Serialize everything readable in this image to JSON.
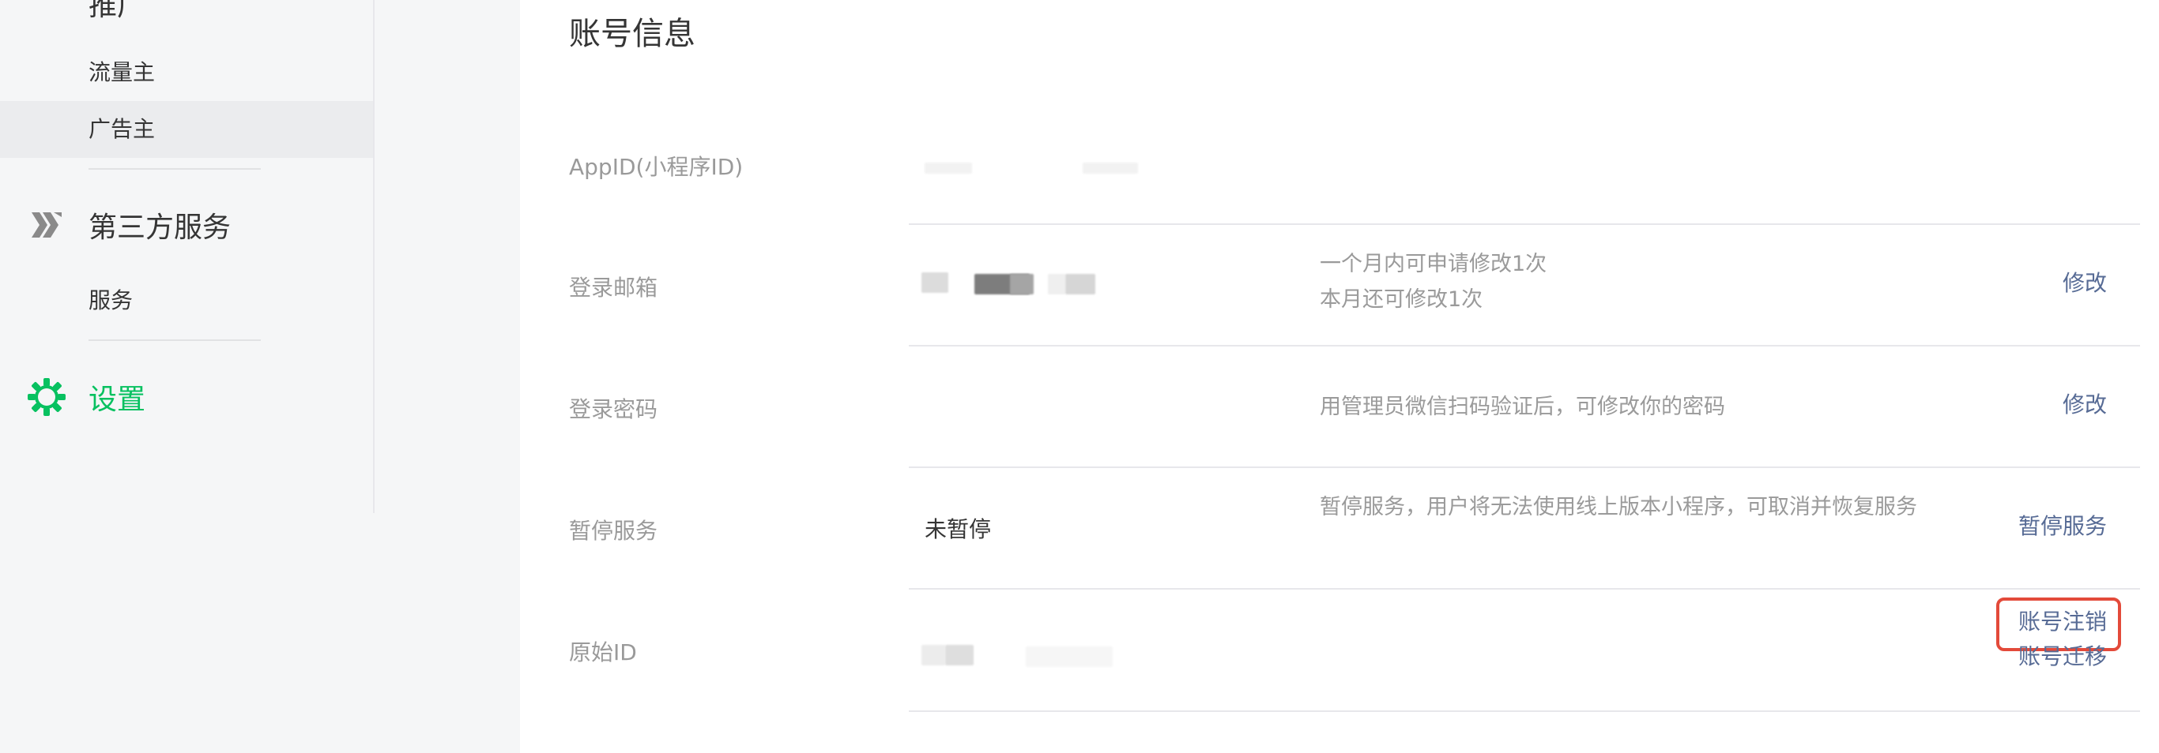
{
  "sidebar": {
    "clipped_section_label": "推广",
    "items": [
      {
        "label": "流量主",
        "active": false
      },
      {
        "label": "广告主",
        "active": true
      }
    ],
    "third_party": {
      "section_label": "第三方服务",
      "items": [
        {
          "label": "服务"
        }
      ]
    },
    "settings": {
      "section_label": "设置"
    }
  },
  "main": {
    "title": "账号信息",
    "rows": [
      {
        "label": "AppID(小程序ID)",
        "value": "",
        "desc": [],
        "actions": []
      },
      {
        "label": "登录邮箱",
        "value": "",
        "desc": [
          "一个月内可申请修改1次",
          "本月还可修改1次"
        ],
        "actions": [
          "修改"
        ]
      },
      {
        "label": "登录密码",
        "value": "",
        "desc": [
          "用管理员微信扫码验证后，可修改你的密码"
        ],
        "actions": [
          "修改"
        ]
      },
      {
        "label": "暂停服务",
        "value": "未暂停",
        "desc": [
          "暂停服务，用户将无法使用线上版本小程序，可取消并恢复服务"
        ],
        "actions": [
          "暂停服务"
        ]
      },
      {
        "label": "原始ID",
        "value": "",
        "desc": [],
        "actions": [
          "账号注销",
          "账号迁移"
        ]
      }
    ]
  },
  "colors": {
    "link": "#576b95",
    "settings_green": "#07c160",
    "highlight_red": "#e34a3a"
  },
  "icons": {
    "clipped_section": "promotion-icon",
    "third_party": "third-party-service-icon",
    "settings": "gear-icon"
  }
}
